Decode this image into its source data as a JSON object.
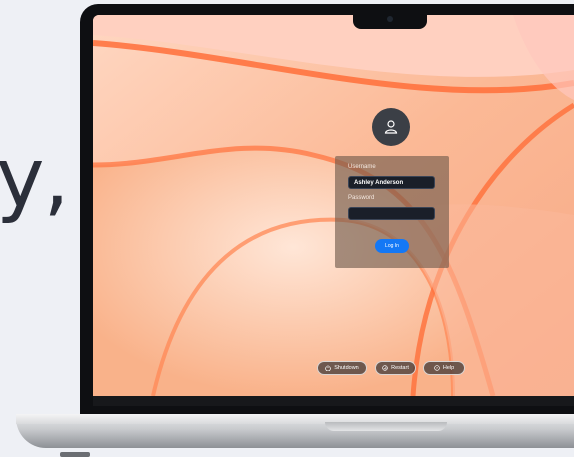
{
  "hero": {
    "partial_text": "y,"
  },
  "login": {
    "username_label": "Username",
    "username_value": "Ashley Anderson",
    "password_label": "Password",
    "password_value": "",
    "login_button": "Log In"
  },
  "system_buttons": {
    "shutdown": "Shutdown",
    "restart": "Restart",
    "help": "Help"
  },
  "colors": {
    "accent": "#1478f5",
    "wallpaper_primary": "#f9b184",
    "wallpaper_accent": "#ff7a45"
  },
  "icons": {
    "avatar": "user-icon",
    "shutdown": "power-icon",
    "restart": "restart-icon",
    "help": "help-icon"
  }
}
